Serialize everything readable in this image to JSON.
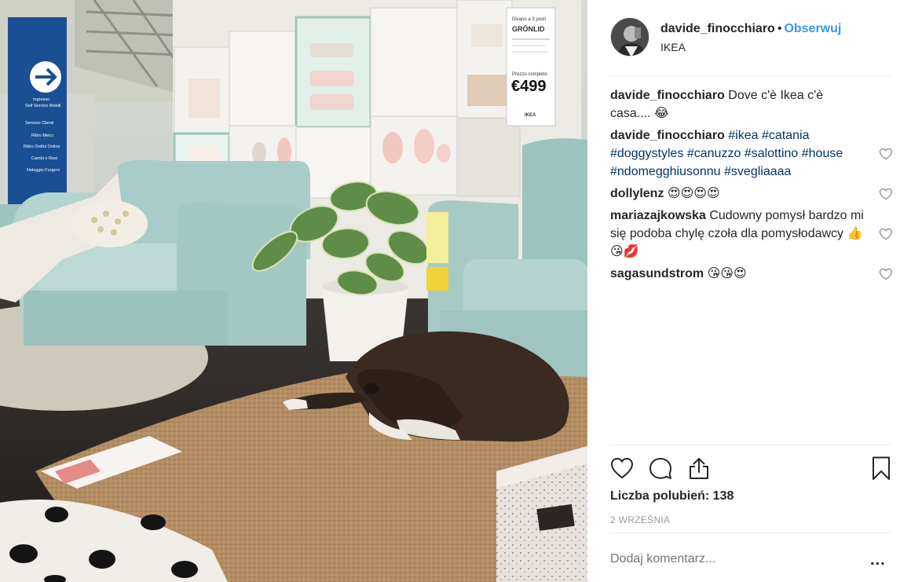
{
  "post": {
    "author": "davide_finocchiaro",
    "separator": "•",
    "follow_label": "Obserwuj",
    "location": "IKEA",
    "likes_label": "Liczba polubień: 138",
    "date": "2 WRZEŚNIA",
    "comment_placeholder": "Dodaj komentarz...",
    "more_label": "..."
  },
  "comments": [
    {
      "user": "davide_finocchiaro",
      "text": "Dove c'è Ikea c'è casa.... 😂",
      "tags": [],
      "likeable": false
    },
    {
      "user": "davide_finocchiaro",
      "text": "",
      "tags": [
        "#ikea",
        "#catania",
        "#doggystyles",
        "#canuzzo",
        "#salottino",
        "#house",
        "#ndomegghiusonnu",
        "#svegliaaaa"
      ],
      "likeable": true
    },
    {
      "user": "dollylenz",
      "text": "😍😍😍😍",
      "tags": [],
      "likeable": true
    },
    {
      "user": "mariazajkowska",
      "text": "Cudowny pomysł bardzo mi się podoba chylę czoła dla pomysłodawcy 👍😘💋",
      "tags": [],
      "likeable": true
    },
    {
      "user": "sagasundstrom",
      "text": "😘😘😍",
      "tags": [],
      "likeable": true
    }
  ],
  "photo": {
    "price_tag_top": "Divano a 3 posti",
    "price_tag_name": "GRÖNLID",
    "price_tag_sub": "Prezzo completo",
    "price": "€499",
    "price_tag_brand": "IKEA",
    "sign_line1": "Ingresso",
    "sign_line2": "Self Service Mobili",
    "sign_line3": "Servizio Clienti",
    "sign_line4": "Ritiro Merci",
    "sign_line5": "Ritiro Ordini Online",
    "sign_line6": "Cambi e Resi",
    "sign_line7": "Noleggio Furgoni"
  },
  "icons": {
    "like": "heart-icon",
    "comment": "comment-bubble-icon",
    "share": "share-icon",
    "save": "bookmark-icon",
    "comment_like": "heart-outline-icon",
    "arrow": "arrow-right-icon"
  },
  "colors": {
    "link_blue": "#3897f0",
    "hashtag_blue": "#003569",
    "text": "#262626",
    "muted": "#999999",
    "divider": "#efefef"
  }
}
